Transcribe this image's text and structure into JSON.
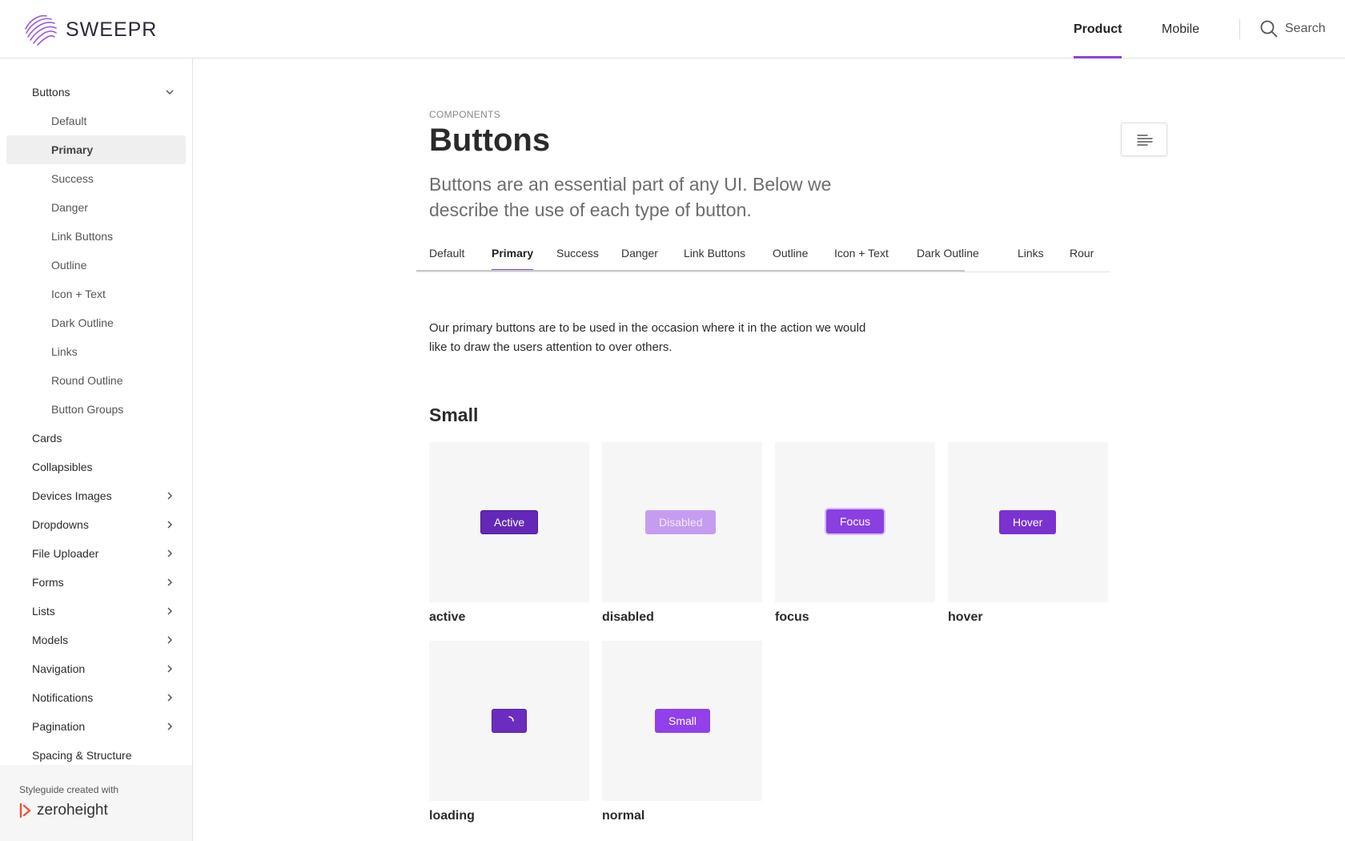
{
  "brand": {
    "name": "SWEEPR",
    "accent": "#8a3fe0"
  },
  "header": {
    "nav": [
      {
        "label": "Product",
        "active": true
      },
      {
        "label": "Mobile",
        "active": false
      }
    ],
    "search_label": "Search"
  },
  "sidebar": {
    "items": [
      {
        "label": "Buttons",
        "expanded": true
      },
      {
        "label": "Default"
      },
      {
        "label": "Primary",
        "selected": true
      },
      {
        "label": "Success"
      },
      {
        "label": "Danger"
      },
      {
        "label": "Link Buttons"
      },
      {
        "label": "Outline"
      },
      {
        "label": "Icon + Text"
      },
      {
        "label": "Dark Outline"
      },
      {
        "label": "Links"
      },
      {
        "label": "Round Outline"
      },
      {
        "label": "Button Groups"
      },
      {
        "label": "Cards"
      },
      {
        "label": "Collapsibles"
      },
      {
        "label": "Devices Images"
      },
      {
        "label": "Dropdowns"
      },
      {
        "label": "File Uploader"
      },
      {
        "label": "Forms"
      },
      {
        "label": "Lists"
      },
      {
        "label": "Models"
      },
      {
        "label": "Navigation"
      },
      {
        "label": "Notifications"
      },
      {
        "label": "Pagination"
      },
      {
        "label": "Spacing & Structure"
      }
    ],
    "footer": {
      "caption": "Styleguide created with",
      "brand": "zeroheight"
    }
  },
  "page": {
    "eyebrow": "COMPONENTS",
    "title": "Buttons",
    "lead": "Buttons are an essential part of any UI. Below we describe the use of each type of button.",
    "tabs": [
      "Default",
      "Primary",
      "Success",
      "Danger",
      "Link Buttons",
      "Outline",
      "Icon + Text",
      "Dark Outline",
      "Links",
      "Rour"
    ],
    "active_tab": "Primary",
    "description": "Our primary buttons are to be used in the occasion where it in the action we would like to draw the users attention to over others.",
    "section_title": "Small",
    "states": [
      {
        "label": "active",
        "button": "Active"
      },
      {
        "label": "disabled",
        "button": "Disabled"
      },
      {
        "label": "focus",
        "button": "Focus"
      },
      {
        "label": "hover",
        "button": "Hover"
      },
      {
        "label": "loading",
        "button": ""
      },
      {
        "label": "normal",
        "button": "Small"
      }
    ]
  }
}
